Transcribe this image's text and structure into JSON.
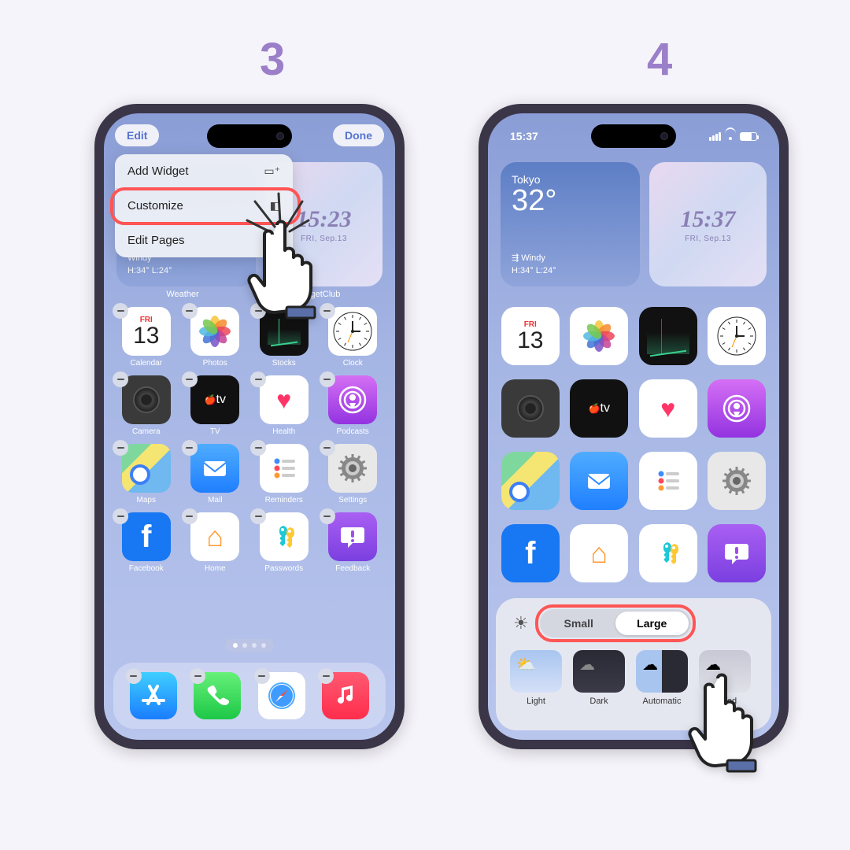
{
  "steps": {
    "s3": "3",
    "s4": "4"
  },
  "toolbar": {
    "edit": "Edit",
    "done": "Done"
  },
  "status": {
    "time": "15:37"
  },
  "weather": {
    "city": "Tokyo",
    "temp": "32°",
    "cond": "Windy",
    "hilo": "H:34° L:24°"
  },
  "clockWidget": {
    "time": "15:37",
    "date": "FRI, Sep.13"
  },
  "clockWidget3": {
    "time": "15:23",
    "date": "FRI, Sep.13"
  },
  "widgetLabels": {
    "weather": "Weather",
    "wc": "WidgetClub"
  },
  "menu": {
    "add": "Add Widget",
    "customize": "Customize",
    "editPages": "Edit Pages"
  },
  "cal": {
    "day": "FRI",
    "num": "13"
  },
  "apps": {
    "calendar": "Calendar",
    "photos": "Photos",
    "stocks": "Stocks",
    "clock": "Clock",
    "camera": "Camera",
    "tv": "TV",
    "health": "Health",
    "podcasts": "Podcasts",
    "maps": "Maps",
    "mail": "Mail",
    "reminders": "Reminders",
    "settings": "Settings",
    "facebook": "Facebook",
    "home": "Home",
    "passwords": "Passwords",
    "feedback": "Feedback"
  },
  "tvText": "tv",
  "seg": {
    "small": "Small",
    "large": "Large"
  },
  "themes": {
    "light": "Light",
    "dark": "Dark",
    "auto": "Automatic",
    "tinted": "Tinted"
  }
}
